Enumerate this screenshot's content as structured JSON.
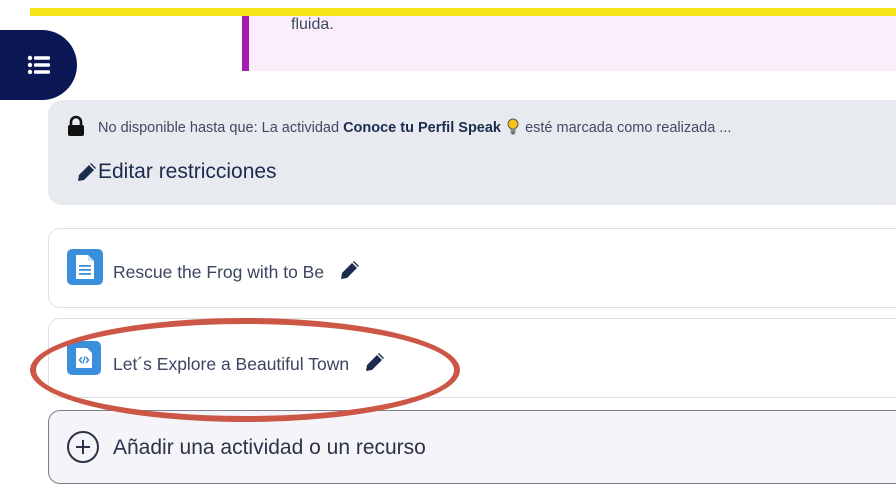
{
  "note": {
    "text": "fluida."
  },
  "restriction": {
    "prefix": "No disponible hasta que: La actividad",
    "activity": "Conoce tu Perfil Speak",
    "suffix": "esté marcada como realizada ...",
    "edit_label": "Editar restricciones"
  },
  "activities": [
    {
      "title": "Rescue the Frog with to Be",
      "icon": "page-icon"
    },
    {
      "title": "Let´s Explore a Beautiful Town",
      "icon": "html-code-icon"
    }
  ],
  "add_activity": {
    "label": "Añadir una actividad o un recurso"
  },
  "colors": {
    "highlight_bar": "#f4e61b",
    "note_border": "#a21fb1",
    "index_button": "#0b1655",
    "activity_icon": "#3a8fdc",
    "annotation_oval": "#cd5746"
  }
}
